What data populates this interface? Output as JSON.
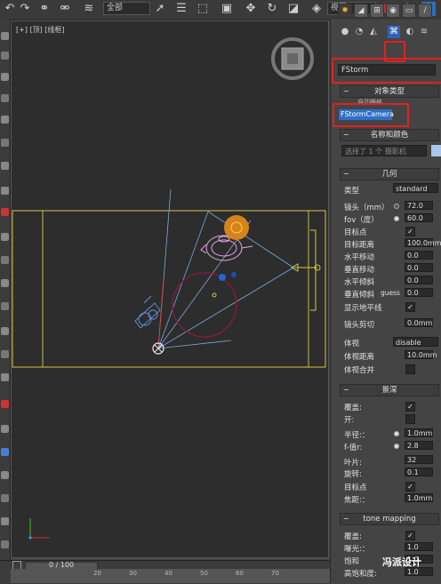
{
  "toolbar": {
    "selection_filter": "全部",
    "view_dropdown": "视图"
  },
  "viewport": {
    "label": "[+] [顶] [线框]"
  },
  "panel": {
    "category_dropdown": "FStorm",
    "object_type": {
      "header": "对象类型",
      "autogrid_label": "自动栅格",
      "camera_button": "FStormCamera"
    },
    "name_color": {
      "header": "名称和颜色",
      "name_value": "选择了 1 个 摄影机",
      "swatch_color": "#a9c7ee"
    },
    "geometry": {
      "header": "几何",
      "type_label": "类型",
      "type_value": "standard",
      "lens_label": "镜头（mm）",
      "lens_value": "72.0",
      "fov_label": "fov（度）",
      "fov_value": "60.0",
      "target_label": "目标点",
      "target_distance_label": "目标距离",
      "target_distance_value": "100.0mm",
      "hshift_label": "水平移动",
      "hshift_value": "0.0",
      "vshift_label": "垂直移动",
      "vshift_value": "0.0",
      "htilt_label": "水平倾斜",
      "htilt_value": "0.0",
      "vtilt_label": "垂直倾斜",
      "guess_label": "guess",
      "vtilt_value": "0.0",
      "show_horizon_label": "显示地平线",
      "clipping_label": "镜头剪切",
      "clipping_value": "0.0mm",
      "volume_label": "体视",
      "volume_value": "disable",
      "volume_distance_label": "体视距离",
      "volume_distance_value": "10.0mm",
      "volume_merge_label": "体视合并"
    },
    "dof": {
      "header": "景深",
      "override_label": "覆盖:",
      "on_label": "开:",
      "radius_label": "半径:：",
      "radius_value": "1.0mm",
      "fnumber_label": "f-值r:",
      "fnumber_value": "2.8",
      "blades_label": "叶片:",
      "blades_value": "32",
      "rotation_label": "旋转:",
      "rotation_value": "0.1",
      "target_label": "目标点",
      "focus_label": "焦距:：",
      "focus_value": "1.0mm"
    },
    "tone": {
      "header": "tone mapping",
      "override_label": "覆盖:",
      "exposure_label": "曝光:：",
      "exposure_value": "1.0",
      "saturation_label": "饱和",
      "saturation_value": "1.0",
      "highlight_label": "高饱和度:",
      "highlight_value": "1.0"
    }
  },
  "timeline": {
    "frame_counter": "0 / 100",
    "ticks": [
      "20",
      "30",
      "40",
      "50",
      "60",
      "70"
    ]
  },
  "watermark": "冯派设计"
}
